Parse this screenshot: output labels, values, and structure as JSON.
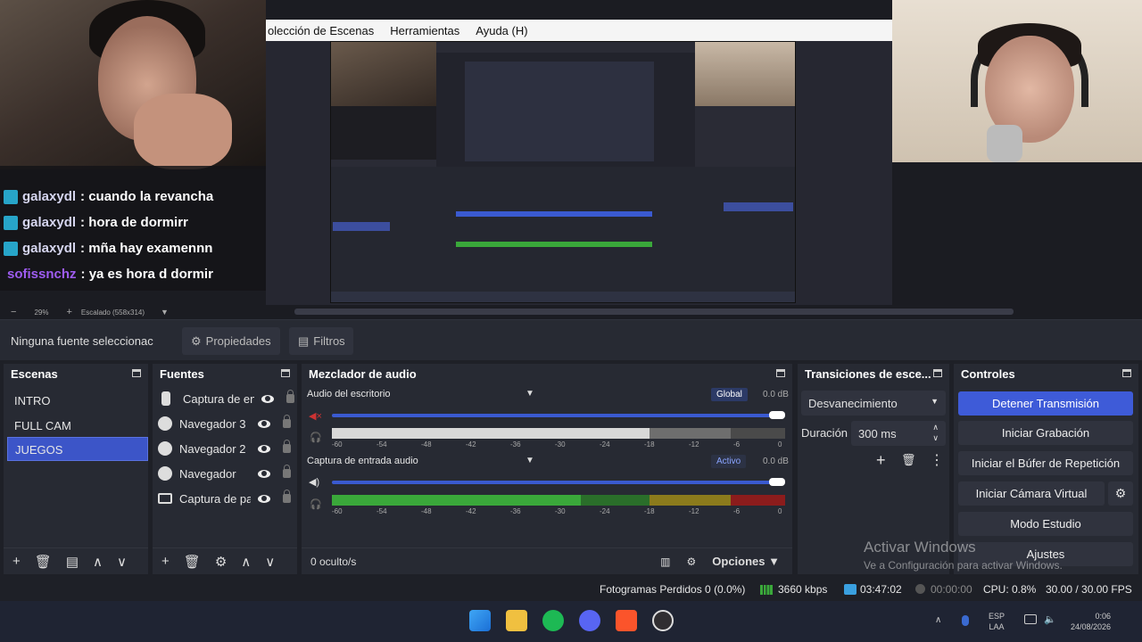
{
  "menubar": {
    "items": [
      "olección de Escenas",
      "Herramientas",
      "Ayuda (H)"
    ]
  },
  "chat": [
    {
      "user": "galaxydl",
      "message": ": cuando la revancha",
      "color": "#d6d6f0"
    },
    {
      "user": "galaxydl",
      "message": ": hora de dormirr",
      "color": "#d6d6f0"
    },
    {
      "user": "galaxydl",
      "message": ": mña hay examennn",
      "color": "#d6d6f0"
    },
    {
      "user": "sofissnchz",
      "message": ": ya es hora d dormir",
      "color": "#9e5cf0"
    }
  ],
  "preview_toolbar": {
    "zoom": "29%",
    "scale": "Escalado (558x314)"
  },
  "props_bar": {
    "no_source": "Ninguna fuente seleccionac",
    "properties": "Propiedades",
    "filters": "Filtros"
  },
  "scenes": {
    "title": "Escenas",
    "items": [
      "INTRO",
      "FULL CAM",
      "JUEGOS"
    ],
    "selected": "JUEGOS"
  },
  "sources": {
    "title": "Fuentes",
    "items": [
      "Captura de en",
      "Navegador 3",
      "Navegador 2",
      "Navegador",
      "Captura de pa"
    ]
  },
  "mixer": {
    "title": "Mezclador de audio",
    "channels": [
      {
        "name": "Audio del escritorio",
        "badge": "Global",
        "db": "0.0 dB",
        "level": 0.55
      },
      {
        "name": "Captura de entrada audio",
        "badge": "Activo",
        "db": "0.0 dB",
        "level": 0.8
      }
    ],
    "scale": [
      "-60",
      "-54",
      "-48",
      "-42",
      "-36",
      "-30",
      "-24",
      "-18",
      "-12",
      "-6",
      "0"
    ],
    "hidden": "0 oculto/s",
    "options": "Opciones"
  },
  "transitions": {
    "title": "Transiciones de esce...",
    "transition": "Desvanecimiento",
    "duration_label": "Duración",
    "duration_value": "300 ms"
  },
  "controls": {
    "title": "Controles",
    "buttons": [
      "Detener Transmisión",
      "Iniciar Grabación",
      "Iniciar el Búfer de Repetición",
      "Iniciar Cámara Virtual",
      "Modo Estudio",
      "Ajustes"
    ]
  },
  "watermark": {
    "line1": "Activar Windows",
    "line2": "Ve a Configuración para activar Windows."
  },
  "status": {
    "dropped": "Fotogramas Perdidos 0 (0.0%)",
    "bitrate": "3660 kbps",
    "live_time": "03:47:02",
    "rec_time": "00:00:00",
    "cpu": "CPU: 0.8%",
    "fps": "30.00 / 30.00 FPS"
  },
  "taskbar": {
    "lang1": "ESP",
    "lang2": "LAA",
    "time": "0:06",
    "date": "24/08/2026"
  },
  "colors": {
    "accent": "#3e5bd8",
    "panel": "#272a33",
    "bg": "#1e2027"
  }
}
